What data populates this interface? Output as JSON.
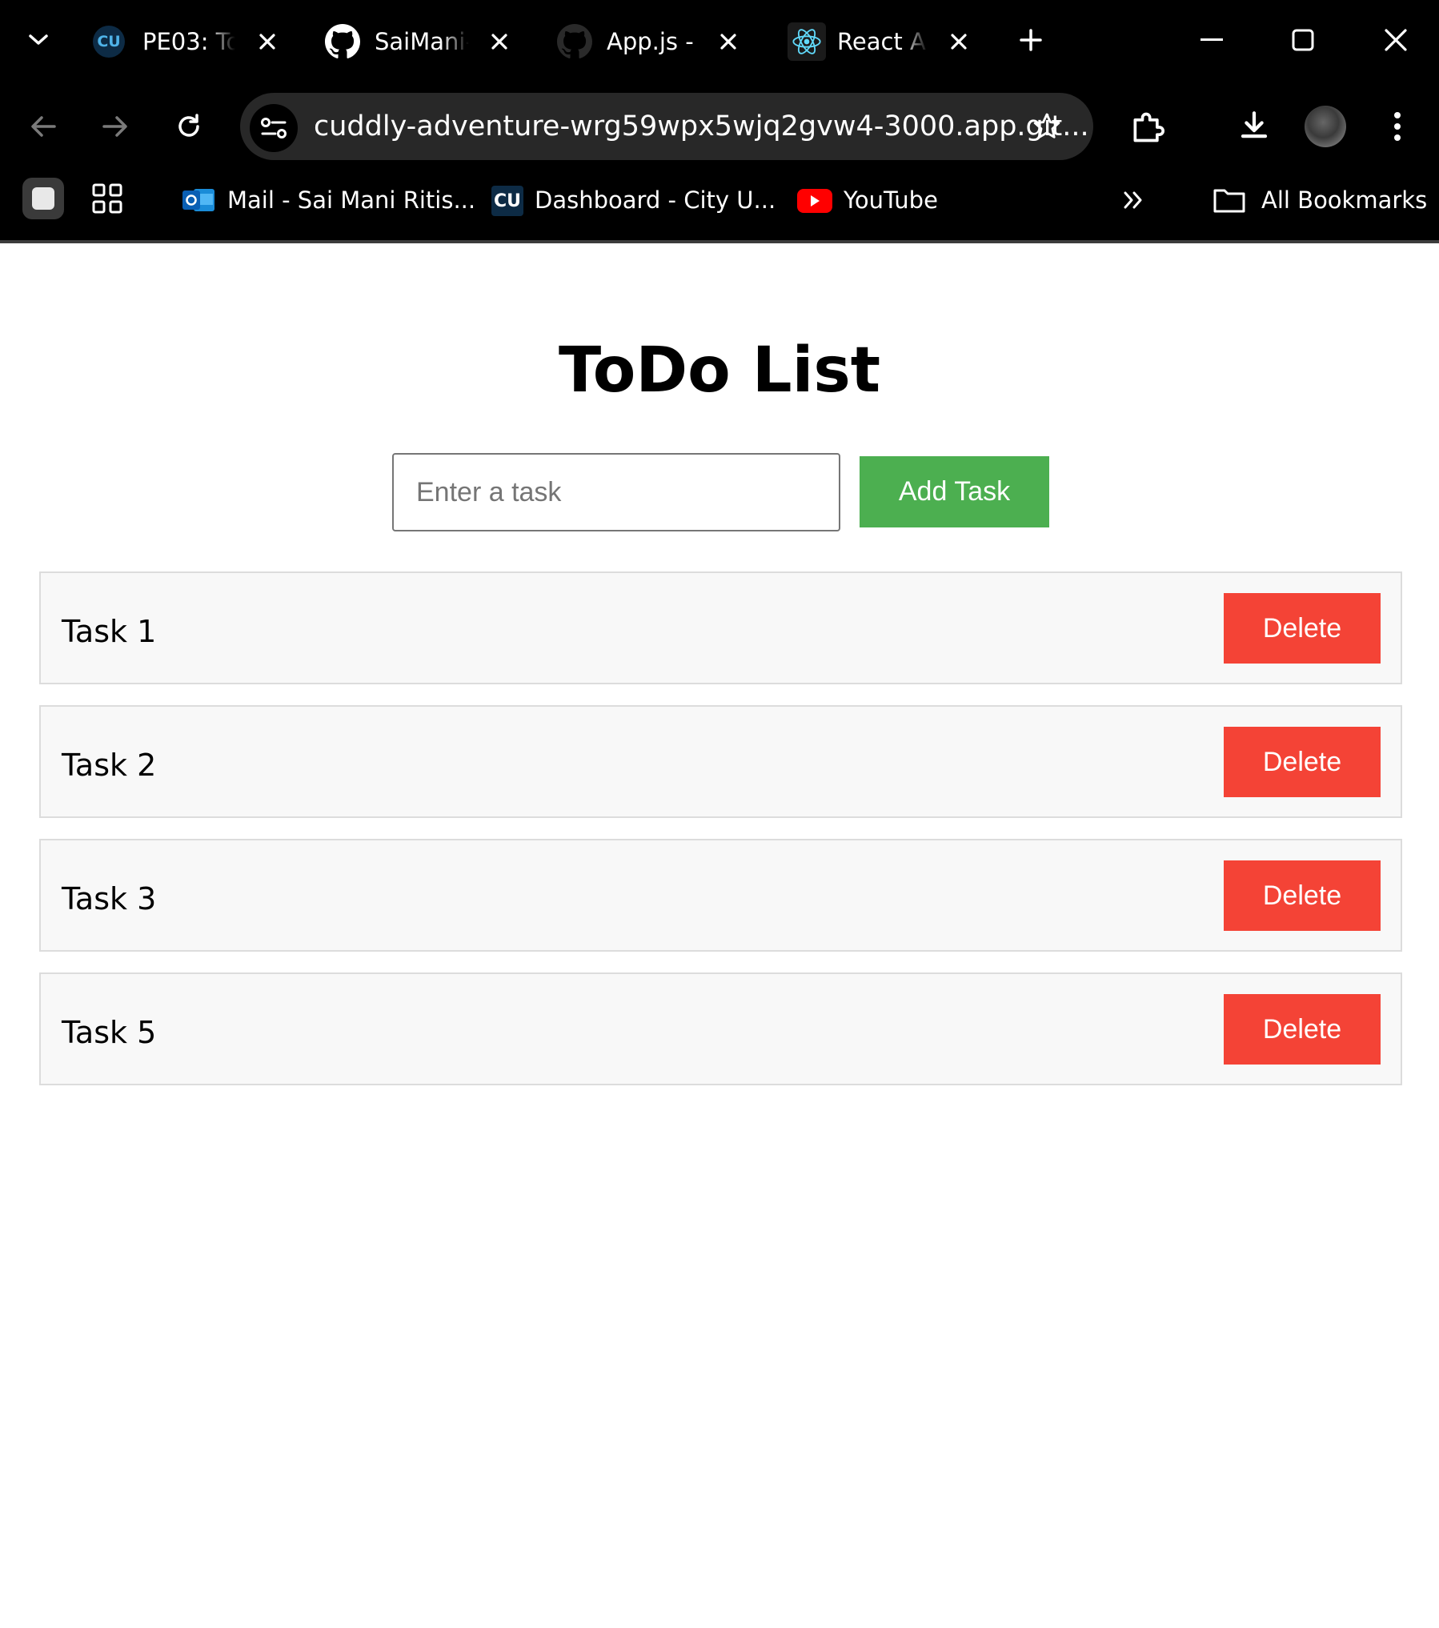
{
  "browser": {
    "tabs": [
      {
        "title": "PE03: To",
        "favicon": "cu-logo-icon"
      },
      {
        "title": "SaiMani-",
        "favicon": "github-icon"
      },
      {
        "title": "App.js -",
        "favicon": "github-icon"
      },
      {
        "title": "React Ap",
        "favicon": "react-icon"
      }
    ],
    "address_url": "cuddly-adventure-wrg59wpx5wjq2gvw4-3000.app.git...",
    "bookmarks": [
      {
        "label": "Mail - Sai Mani Ritis...",
        "icon": "outlook-icon"
      },
      {
        "label": "Dashboard - City U...",
        "icon": "cu-logo-icon"
      },
      {
        "label": "YouTube",
        "icon": "youtube-icon"
      }
    ],
    "all_bookmarks_label": "All Bookmarks",
    "favicon_text": "CU"
  },
  "app": {
    "title": "ToDo List",
    "input_placeholder": "Enter a task",
    "input_value": "",
    "add_button_label": "Add Task",
    "delete_label": "Delete",
    "tasks": [
      "Task 1",
      "Task 2",
      "Task 3",
      "Task 5"
    ],
    "colors": {
      "add_button": "#4CAF50",
      "delete_button": "#f44336"
    }
  }
}
